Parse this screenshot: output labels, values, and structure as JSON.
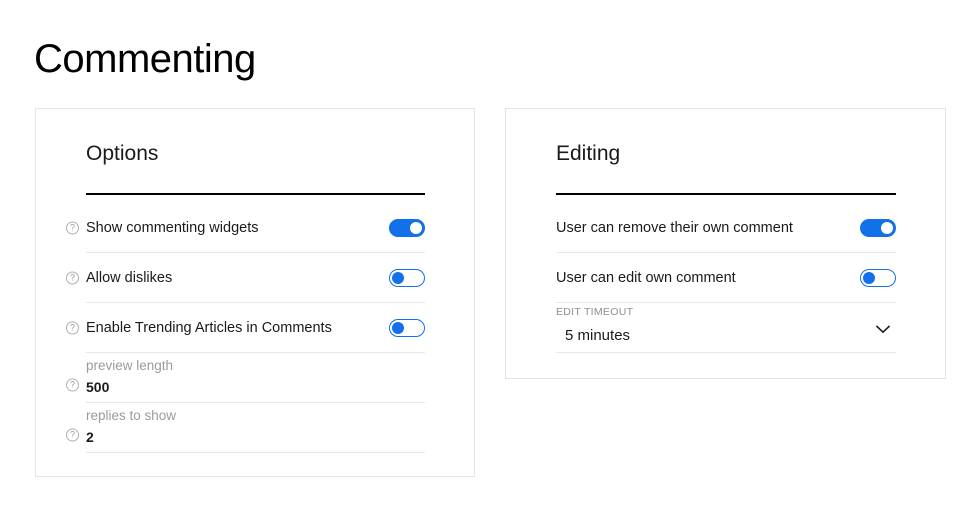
{
  "page": {
    "title": "Commenting",
    "background": "#ffffff",
    "accent": "#1270e8"
  },
  "cards": [
    {
      "id": "options",
      "title": "Options",
      "rows": [
        {
          "kind": "toggle",
          "help_icon": "help-circle-icon",
          "label": "Show commenting widgets",
          "state": "on"
        },
        {
          "kind": "toggle",
          "help_icon": "help-circle-icon",
          "label": "Allow dislikes",
          "state": "off"
        },
        {
          "kind": "toggle",
          "help_icon": "help-circle-icon",
          "label": "Enable Trending Articles in Comments",
          "state": "off"
        },
        {
          "kind": "field",
          "help_icon": "help-circle-icon",
          "label": "preview length",
          "value": "500"
        },
        {
          "kind": "field",
          "help_icon": "help-circle-icon",
          "label": "replies to show",
          "value": "2"
        }
      ]
    },
    {
      "id": "editing",
      "title": "Editing",
      "rows": [
        {
          "kind": "toggle",
          "label": "User can remove their own comment",
          "state": "on"
        },
        {
          "kind": "toggle",
          "label": "User can edit own comment",
          "state": "off"
        },
        {
          "kind": "select",
          "label": "EDIT TIMEOUT",
          "value": "5 minutes",
          "chevron_icon": "chevron-down-icon"
        }
      ]
    }
  ]
}
